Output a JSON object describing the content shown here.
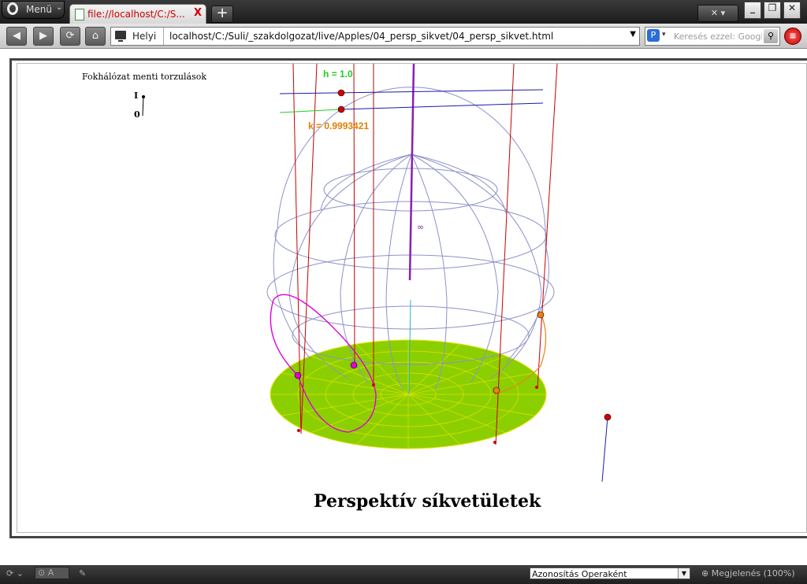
{
  "browser": {
    "menu_label": "Menü",
    "tab_title": "file://localhost/C:/S...",
    "tab_close": "X",
    "new_tab": "+",
    "trash_label": "✕ ▾",
    "win_min": "_",
    "win_max": "❐",
    "win_close": "✕"
  },
  "toolbar": {
    "back": "◀",
    "forward": "▶",
    "reload": "⟳",
    "home": "⌂",
    "place_label": "Helyi",
    "url": "localhost/C:/Suli/_szakdolgozat/live/Apples/04_persp_sikvet/04_persp_sikvet.html",
    "search_placeholder": "Keresés ezzel: Google",
    "search_engine": "P",
    "stop": "≡"
  },
  "applet": {
    "top_label": "Fokhálózat menti torzulások",
    "slider_top": "I",
    "slider_bottom": "0",
    "h_label": "h = 1.0",
    "k_label": "k = 0.9993421",
    "infinity": "∞",
    "title": "Perspektív síkvetületek",
    "colors": {
      "h_color": "#22cc22",
      "k_color": "#e08000",
      "disc_fill": "#8ccf00",
      "disc_line": "#e6e600",
      "grid_line": "#8c92c9",
      "ray_color": "#c80000",
      "axis_color": "#8a1fb0",
      "magenta": "#e000d8",
      "orange": "#f08010"
    }
  },
  "status": {
    "zoom_icon": "⊙",
    "identity_select": "Azonosítás Operaként",
    "zoom_text": "Megjelenés (100%)",
    "icon_a": "A"
  }
}
